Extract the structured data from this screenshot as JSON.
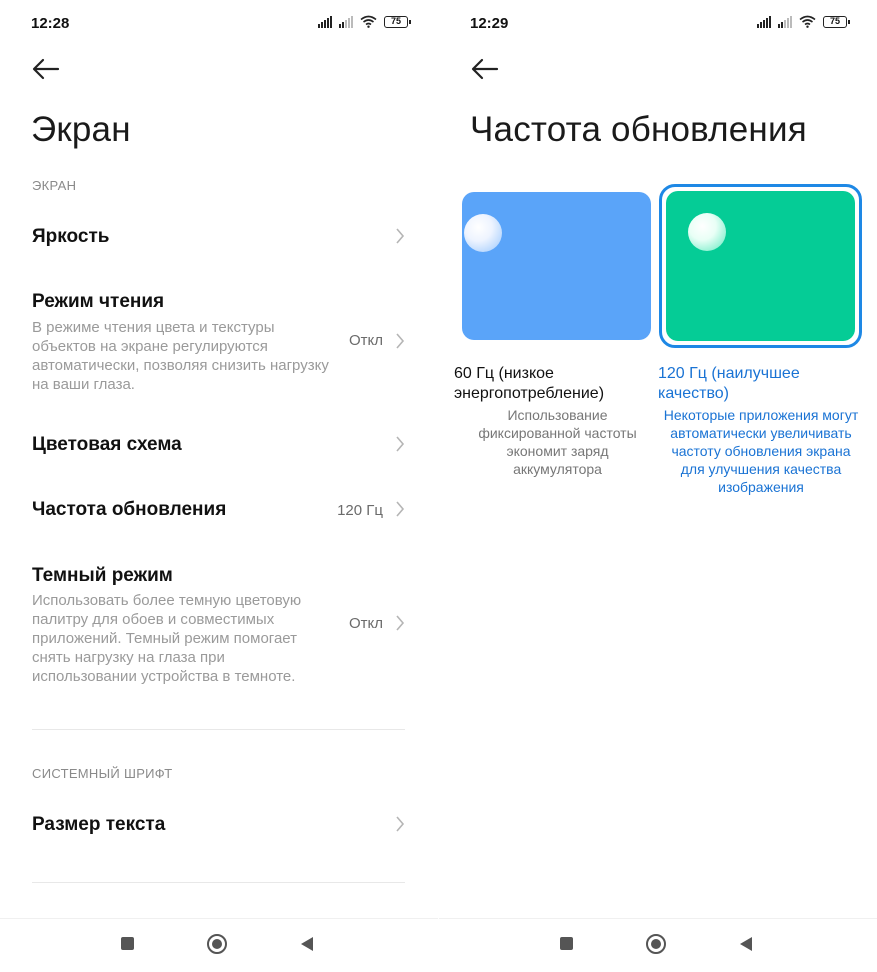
{
  "left": {
    "status": {
      "time": "12:28",
      "battery": "75"
    },
    "title": "Экран",
    "section_screen": "ЭКРАН",
    "items": [
      {
        "title": "Яркость"
      },
      {
        "title": "Режим чтения",
        "desc": "В режиме чтения цвета и текстуры объектов на экране регулируются автоматически, позволяя снизить нагрузку на ваши глаза.",
        "value": "Откл"
      },
      {
        "title": "Цветовая схема"
      },
      {
        "title": "Частота обновления",
        "value": "120 Гц"
      },
      {
        "title": "Темный режим",
        "desc": "Использовать более темную цветовую палитру для обоев и совместимых приложений. Темный режим помогает снять нагрузку на глаза при использовании устройства в темноте.",
        "value": "Откл"
      }
    ],
    "section_font": "СИСТЕМНЫЙ ШРИФТ",
    "font_items": [
      {
        "title": "Размер текста"
      }
    ]
  },
  "right": {
    "status": {
      "time": "12:29",
      "battery": "75"
    },
    "title": "Частота обновления",
    "options": [
      {
        "title": "60 Гц (низкое энергопотребление)",
        "desc": "Использование фиксированной частоты экономит заряд аккумулятора",
        "color": "#5aa4f9",
        "selected": false
      },
      {
        "title": "120 Гц (наилучшее качество)",
        "desc": "Некоторые приложения могут автоматически увеличивать частоту обновления экрана для улучшения качества изображения",
        "color": "#05cc96",
        "selected": true
      }
    ]
  },
  "colors": {
    "accent": "#1a73d4",
    "selection_ring": "#1e88e5"
  },
  "icons": [
    "back-arrow-icon",
    "chevron-right-icon",
    "signal-icon",
    "wifi-icon",
    "battery-icon",
    "recents-icon",
    "home-icon",
    "back-icon"
  ]
}
